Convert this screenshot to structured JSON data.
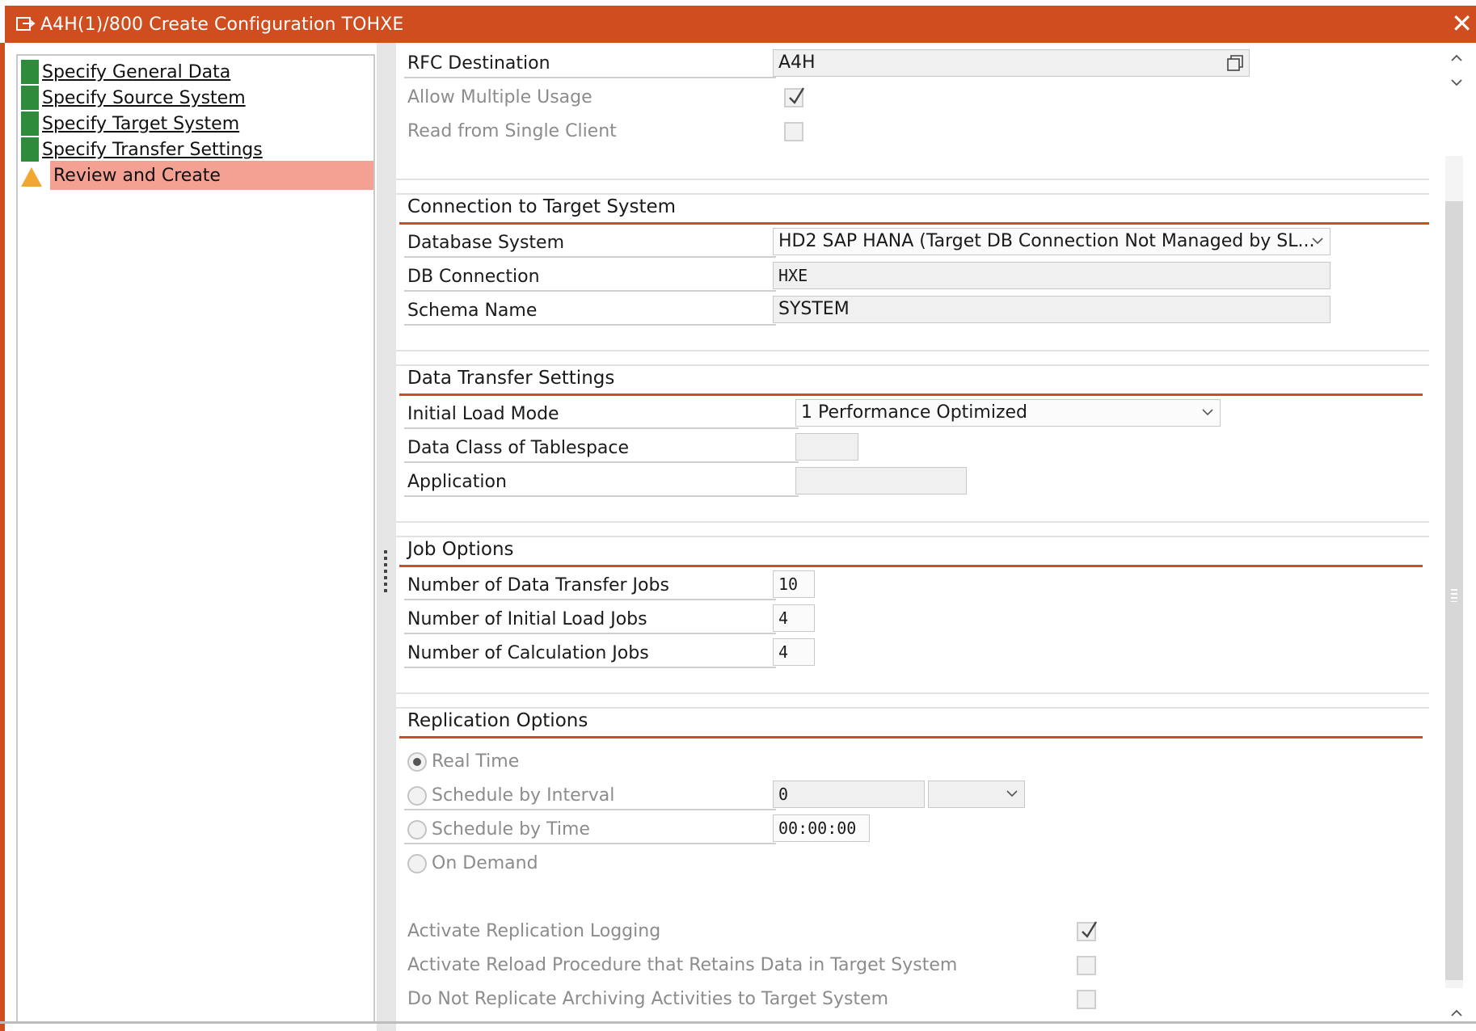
{
  "window": {
    "title": "A4H(1)/800 Create Configuration TOHXE",
    "close": "✕"
  },
  "nav": {
    "items": [
      {
        "label": "Specify General Data",
        "status": "complete"
      },
      {
        "label": "Specify Source System",
        "status": "complete"
      },
      {
        "label": "Specify Target System",
        "status": "complete"
      },
      {
        "label": "Specify Transfer Settings",
        "status": "complete"
      },
      {
        "label": "Review and Create",
        "status": "warning"
      }
    ]
  },
  "source": {
    "rfc_destination_label": "RFC Destination",
    "rfc_destination_value": "A4H",
    "allow_multiple_usage_label": "Allow Multiple Usage",
    "allow_multiple_usage_checked": true,
    "read_single_client_label": "Read from Single Client",
    "read_single_client_checked": false
  },
  "target": {
    "title": "Connection to Target System",
    "db_system_label": "Database System",
    "db_system_value": "HD2 SAP HANA (Target DB Connection Not Managed by SL...",
    "db_connection_label": "DB Connection",
    "db_connection_value": "HXE",
    "schema_label": "Schema Name",
    "schema_value": "SYSTEM"
  },
  "transfer": {
    "title": "Data Transfer Settings",
    "initial_load_label": "Initial Load Mode",
    "initial_load_value": "1 Performance Optimized",
    "data_class_label": "Data Class of Tablespace",
    "data_class_value": "",
    "application_label": "Application",
    "application_value": ""
  },
  "jobs": {
    "title": "Job Options",
    "transfer_jobs_label": "Number of Data Transfer Jobs",
    "transfer_jobs_value": "10",
    "initial_load_jobs_label": "Number of Initial Load Jobs",
    "initial_load_jobs_value": "4",
    "calc_jobs_label": "Number of Calculation Jobs",
    "calc_jobs_value": "4"
  },
  "replication": {
    "title": "Replication Options",
    "real_time_label": "Real Time",
    "interval_label": "Schedule by Interval",
    "interval_value": "0",
    "interval_unit": "",
    "by_time_label": "Schedule by Time",
    "by_time_value": "00:00:00",
    "on_demand_label": "On Demand",
    "selected": "real_time",
    "logging_label": "Activate Replication Logging",
    "logging_checked": true,
    "reload_label": "Activate Reload Procedure that Retains Data in Target System",
    "reload_checked": false,
    "archiving_label": "Do Not Replicate Archiving Activities to Target System",
    "archiving_checked": false
  },
  "colors": {
    "accent": "#cf4d1f",
    "complete": "#2e8b3c",
    "warning": "#f0a830",
    "active_row": "#f4a193"
  }
}
